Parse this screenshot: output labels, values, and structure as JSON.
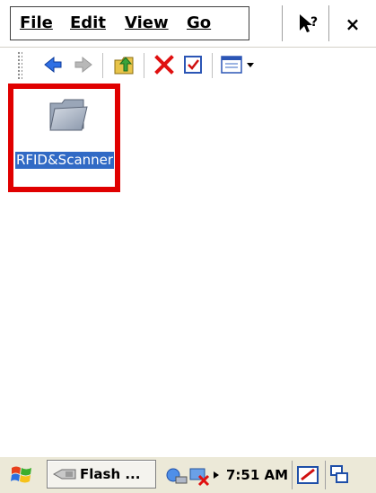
{
  "menubar": {
    "items": [
      {
        "label": "File"
      },
      {
        "label": "Edit"
      },
      {
        "label": "View"
      },
      {
        "label": "Go"
      }
    ],
    "help_label": "?",
    "close_label": "×"
  },
  "toolbar": {
    "buttons": [
      "back-icon",
      "forward-icon",
      "up-folder-icon",
      "delete-icon",
      "properties-icon",
      "views-icon"
    ]
  },
  "content": {
    "folder_label": "RFID&Scanner",
    "selection_color": "#316ac5",
    "highlight_color": "#e00000"
  },
  "taskbar": {
    "task_label": "Flash ...",
    "clock": "7:51 AM"
  }
}
